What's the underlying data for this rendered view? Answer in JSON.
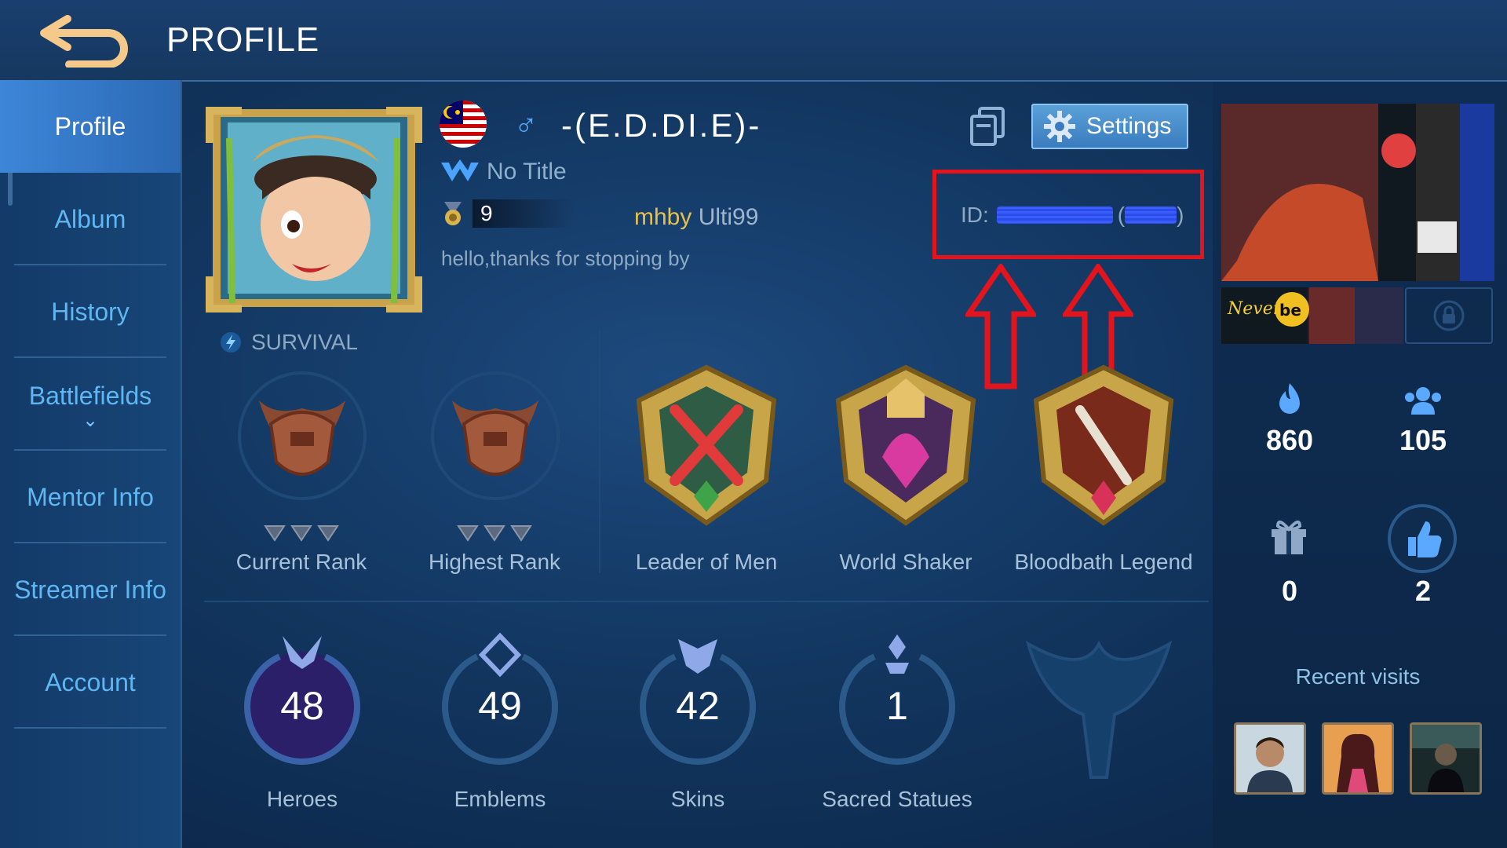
{
  "header": {
    "title": "PROFILE"
  },
  "sidebar": {
    "items": [
      {
        "label": "Profile"
      },
      {
        "label": "Album"
      },
      {
        "label": "History"
      },
      {
        "label": "Battlefields"
      },
      {
        "label": "Mentor Info"
      },
      {
        "label": "Streamer Info"
      },
      {
        "label": "Account"
      }
    ]
  },
  "player": {
    "name": "-(E.D.DI.E)-",
    "title": "No Title",
    "level": "9",
    "squad_tag": "mhby",
    "squad_name": "Ulti99",
    "bio": "hello,thanks for stopping by",
    "id_label": "ID:",
    "mode": "SURVIVAL"
  },
  "settings": {
    "label": "Settings"
  },
  "badges": [
    {
      "label": "Current Rank"
    },
    {
      "label": "Highest Rank"
    },
    {
      "label": "Leader of Men"
    },
    {
      "label": "World Shaker"
    },
    {
      "label": "Bloodbath Legend"
    }
  ],
  "stats": [
    {
      "value": "48",
      "label": "Heroes"
    },
    {
      "value": "49",
      "label": "Emblems"
    },
    {
      "value": "42",
      "label": "Skins"
    },
    {
      "value": "1",
      "label": "Sacred Statues"
    }
  ],
  "social": {
    "popularity": "860",
    "followers": "105",
    "gifts": "0",
    "likes": "2"
  },
  "recent_visits_label": "Recent visits",
  "colors": {
    "accent": "#3d86d8",
    "highlight_box": "#e3141b",
    "gold": "#e7c14d"
  }
}
